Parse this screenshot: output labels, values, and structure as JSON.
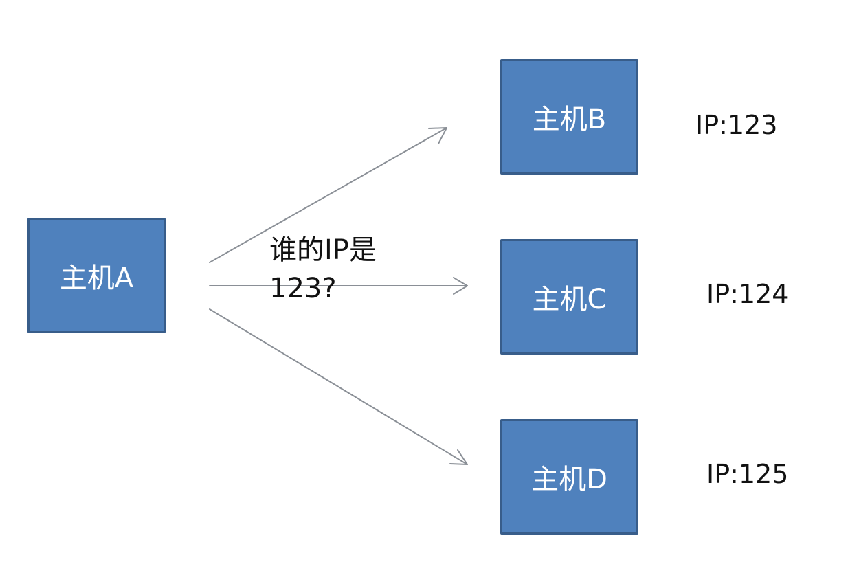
{
  "hosts": {
    "a": {
      "label": "主机A"
    },
    "b": {
      "label": "主机B",
      "ip": "IP:123"
    },
    "c": {
      "label": "主机C",
      "ip": "IP:124"
    },
    "d": {
      "label": "主机D",
      "ip": "IP:125"
    }
  },
  "question": {
    "line1": "谁的IP是",
    "line2": "123?"
  },
  "colors": {
    "box_fill": "#4f81bd",
    "box_border": "#385d8a",
    "box_text": "#ffffff",
    "arrow": "#8a8f96",
    "text": "#111111"
  }
}
